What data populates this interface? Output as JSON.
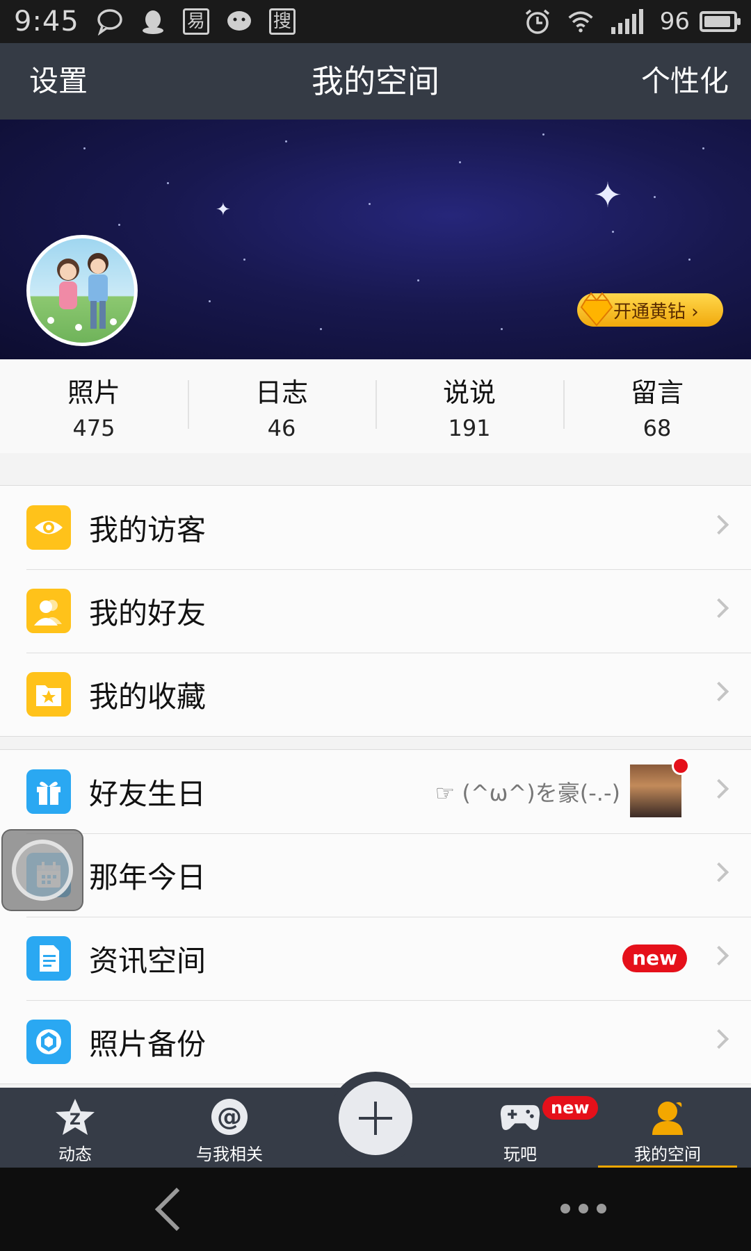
{
  "status_bar": {
    "time": "9:45",
    "battery": "96",
    "icons": [
      "message-icon",
      "qq-icon",
      "app-icon",
      "wechat-icon",
      "sogou-icon",
      "alarm-icon",
      "wifi-icon",
      "signal-icon",
      "battery-icon"
    ],
    "app_glyph_1": "易",
    "app_glyph_2": "搜"
  },
  "nav": {
    "left": "设置",
    "title": "我的空间",
    "right": "个性化"
  },
  "banner": {
    "vip_button": "开通黄钻 ›"
  },
  "stats": [
    {
      "label": "照片",
      "value": "475"
    },
    {
      "label": "日志",
      "value": "46"
    },
    {
      "label": "说说",
      "value": "191"
    },
    {
      "label": "留言",
      "value": "68"
    }
  ],
  "menu_group_1": [
    {
      "label": "我的访客",
      "icon": "eye-icon"
    },
    {
      "label": "我的好友",
      "icon": "friends-icon"
    },
    {
      "label": "我的收藏",
      "icon": "favorites-star-icon"
    }
  ],
  "menu_group_2": [
    {
      "label": "好友生日",
      "icon": "gift-icon",
      "extra": "☞ (^ω^)を豪(-.-)"
    },
    {
      "label": "那年今日",
      "icon": "calendar-icon"
    },
    {
      "label": "资讯空间",
      "icon": "document-icon",
      "badge": "new"
    },
    {
      "label": "照片备份",
      "icon": "photo-backup-icon"
    }
  ],
  "tabbar": [
    {
      "label": "动态",
      "icon": "feed-star-icon"
    },
    {
      "label": "与我相关",
      "icon": "at-icon"
    },
    {
      "label": "玩吧",
      "icon": "gamepad-icon",
      "badge": "new"
    },
    {
      "label": "我的空间",
      "icon": "profile-icon",
      "active": true
    }
  ],
  "colors": {
    "nav_bg": "#353b45",
    "accent_yellow": "#ffc21a",
    "accent_blue": "#2aa8f2",
    "badge_red": "#e5101a",
    "tab_active_underline": "#f3a700"
  }
}
